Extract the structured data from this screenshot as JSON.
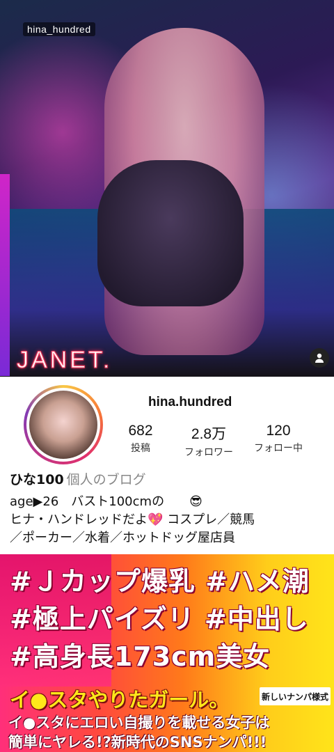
{
  "hero": {
    "handle_overlay": "hina_hundred",
    "watermark": "JANET."
  },
  "profile": {
    "username": "hina.hundred",
    "stats": [
      {
        "value": "682",
        "label": "投稿"
      },
      {
        "value": "2.8万",
        "label": "フォロワー"
      },
      {
        "value": "120",
        "label": "フォロー中"
      }
    ],
    "display_name": "ひな100",
    "category": "個人のブログ",
    "bio_lines": [
      "age▶26　バスト100cmの　　😎",
      "ヒナ・ハンドレッドだよ💖 コスプレ／競馬",
      "／ポーカー／水着／ホットドッグ屋店員"
    ]
  },
  "banner": {
    "tags": [
      "#Ｊカップ爆乳 #ハメ潮",
      "#極上パイズリ #中出し",
      "#高身長173cm美女"
    ],
    "title": "イ●スタやりたガール。",
    "badge": "新しいナンパ様式",
    "subtitle_lines": [
      "イ●スタにエロい自撮りを載せる女子は",
      "簡単にヤレる!?新時代のSNSナンパ!!!"
    ]
  },
  "colors": {
    "banner_pink": "#ff2f7a",
    "banner_yellow": "#ffe41a",
    "story_ring": "#e1306c"
  }
}
